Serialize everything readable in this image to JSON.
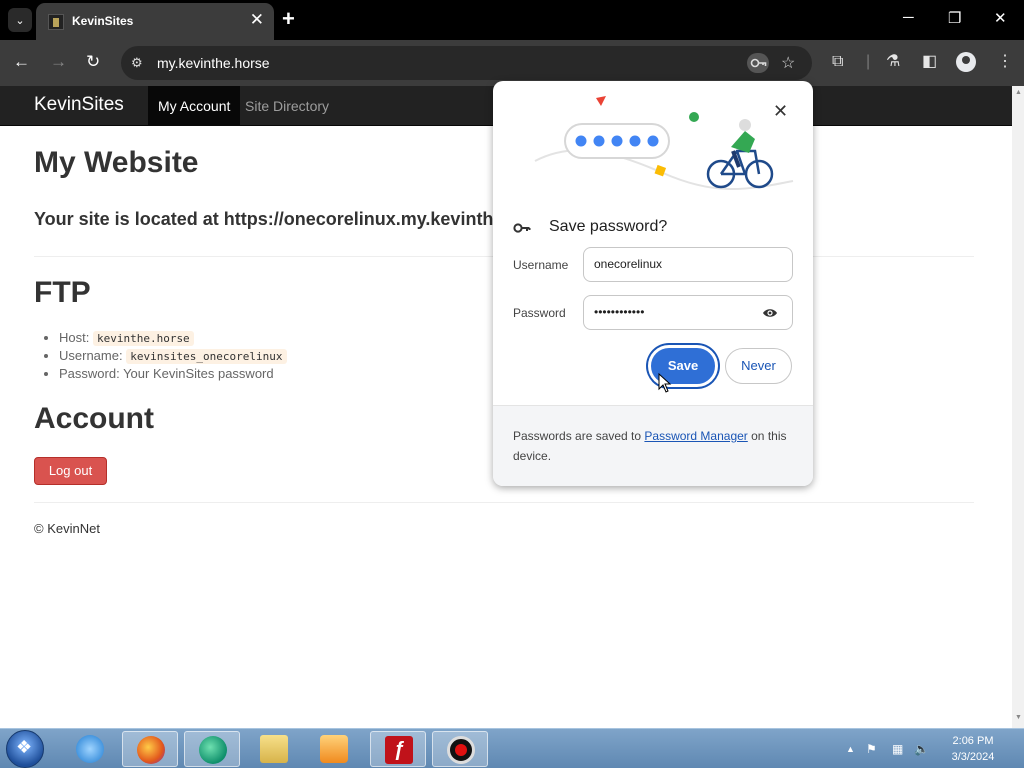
{
  "browser": {
    "tab_title": "KevinSites",
    "url": "my.kevinthe.horse"
  },
  "site": {
    "brand": "KevinSites",
    "nav": [
      "My Account",
      "Site Directory"
    ],
    "title": "My Website",
    "location": "Your site is located at https://onecorelinux.my.kevinth",
    "ftp_heading": "FTP",
    "ftp": {
      "host_label": "Host:",
      "host_value": "kevinthe.horse",
      "username_label": "Username:",
      "username_value": "kevinsites_onecorelinux",
      "password_text": "Password: Your KevinSites password"
    },
    "account_heading": "Account",
    "logout_label": "Log out",
    "footer": "© KevinNet"
  },
  "password_bubble": {
    "title": "Save password?",
    "username_label": "Username",
    "username_value": "onecorelinux",
    "password_label": "Password",
    "password_value": "••••••••••••",
    "save_label": "Save",
    "never_label": "Never",
    "footer_before": "Passwords are saved to ",
    "footer_link": "Password Manager",
    "footer_after": " on this device."
  },
  "taskbar": {
    "time": "2:06 PM",
    "date": "3/3/2024"
  },
  "colors": {
    "accent_blue": "#2f6fd6",
    "danger_red": "#d9534f",
    "navbar": "#222222"
  }
}
